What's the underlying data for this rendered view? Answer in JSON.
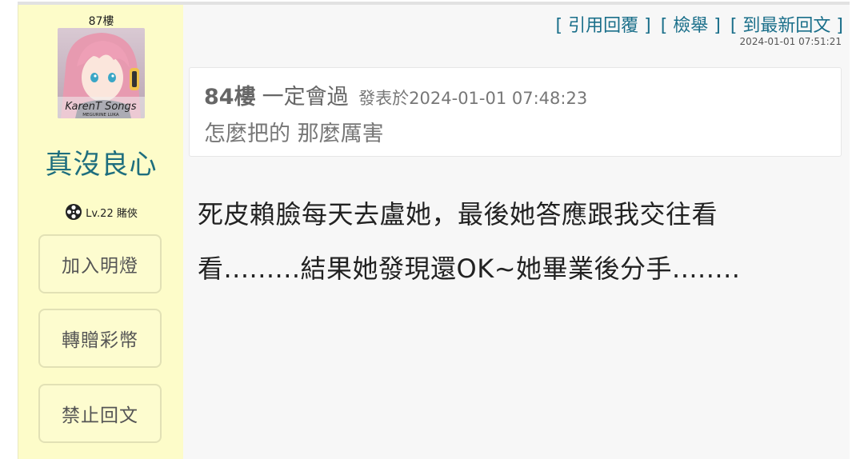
{
  "sidebar": {
    "floor": "87樓",
    "avatar": {
      "icon": "anime-avatar-pink-hair",
      "caption": "KarenT Songs",
      "subcaption": "MEGURINE LUKA"
    },
    "username": "真沒良心",
    "level": {
      "icon": "film-reel-icon",
      "text": "Lv.22 賭俠"
    },
    "buttons": {
      "add_lamp": "加入明燈",
      "gift_coins": "轉贈彩幣",
      "block_reply": "禁止回文"
    }
  },
  "post": {
    "actions": {
      "quote_reply": "[ 引用回覆 ]",
      "report": "[ 檢舉 ]",
      "latest": "[ 到最新回文 ]"
    },
    "timestamp": "2024-01-01 07:51:21",
    "quote": {
      "floor": "84樓",
      "author": "一定會過",
      "meta": "發表於2024-01-01 07:48:23",
      "text": "怎麼把的 那麼厲害"
    },
    "content_lines": [
      "死皮賴臉每天去盧她，最後她答應跟我交往看",
      "看.........結果她發現還OK~她畢業後分手........"
    ]
  },
  "colors": {
    "sidebar_bg": "#fdfcc9",
    "main_bg": "#f7f7f7",
    "accent_link": "#1a6f8a",
    "username": "#1e6e7e"
  }
}
